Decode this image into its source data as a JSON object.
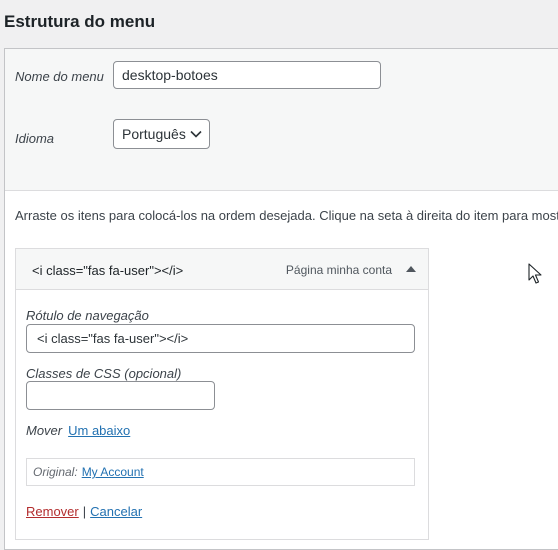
{
  "title": "Estrutura do menu",
  "menu_settings": {
    "name_label": "Nome do menu",
    "name_value": "desktop-botoes",
    "language_label": "Idioma",
    "language_value": "Português"
  },
  "instructions": "Arraste os itens para colocá-los na ordem desejada. Clique na seta à direita do item para mostr",
  "menu_item": {
    "title": "<i class=\"fas fa-user\"></i>",
    "type": "Página minha conta",
    "nav_label_label": "Rótulo de navegação",
    "nav_label_value": "<i class=\"fas fa-user\"></i>",
    "css_label": "Classes de CSS (opcional)",
    "css_value": "",
    "move_label": "Mover",
    "move_link": "Um abaixo",
    "original_label": "Original:",
    "original_link": "My Account",
    "remove_label": "Remover",
    "separator": "|",
    "cancel_label": "Cancelar"
  },
  "icons": {
    "select_arrow": "chevron-down-icon",
    "item_toggle": "caret-up-icon",
    "cursor": "mouse-pointer-icon"
  },
  "colors": {
    "link": "#2271b1",
    "delete": "#b32d2e",
    "border": "#dcdcde",
    "panel_bg": "#f6f7f7"
  }
}
